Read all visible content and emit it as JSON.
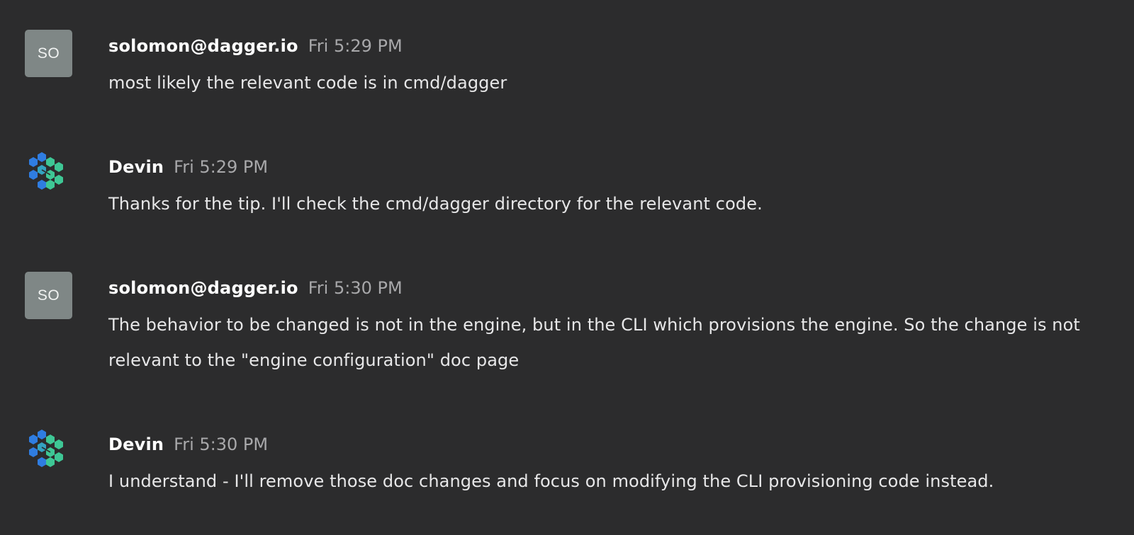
{
  "messages": [
    {
      "avatar_type": "initials",
      "avatar_initials": "SO",
      "author": "solomon@dagger.io",
      "time": "Fri 5:29 PM",
      "text": "most likely the relevant code is in cmd/dagger"
    },
    {
      "avatar_type": "logo",
      "avatar_icon": "devin-hex-logo-icon",
      "author": "Devin",
      "time": "Fri 5:29 PM",
      "text": "Thanks for the tip. I'll check the cmd/dagger directory for the relevant code."
    },
    {
      "avatar_type": "initials",
      "avatar_initials": "SO",
      "author": "solomon@dagger.io",
      "time": "Fri 5:30 PM",
      "text": "The behavior to be changed is not in the engine, but in the CLI which provisions the engine. So the change is not relevant to the \"engine configuration\" doc page"
    },
    {
      "avatar_type": "logo",
      "avatar_icon": "devin-hex-logo-icon",
      "author": "Devin",
      "time": "Fri 5:30 PM",
      "text": "I understand - I'll remove those doc changes and focus on modifying the CLI provisioning code instead."
    }
  ],
  "colors": {
    "background": "#2c2c2d",
    "initials_avatar": "#7f8786",
    "author": "#ffffff",
    "timestamp": "#a8a8aa",
    "logo_blue": "#2f7de1",
    "logo_green": "#3ec795"
  }
}
